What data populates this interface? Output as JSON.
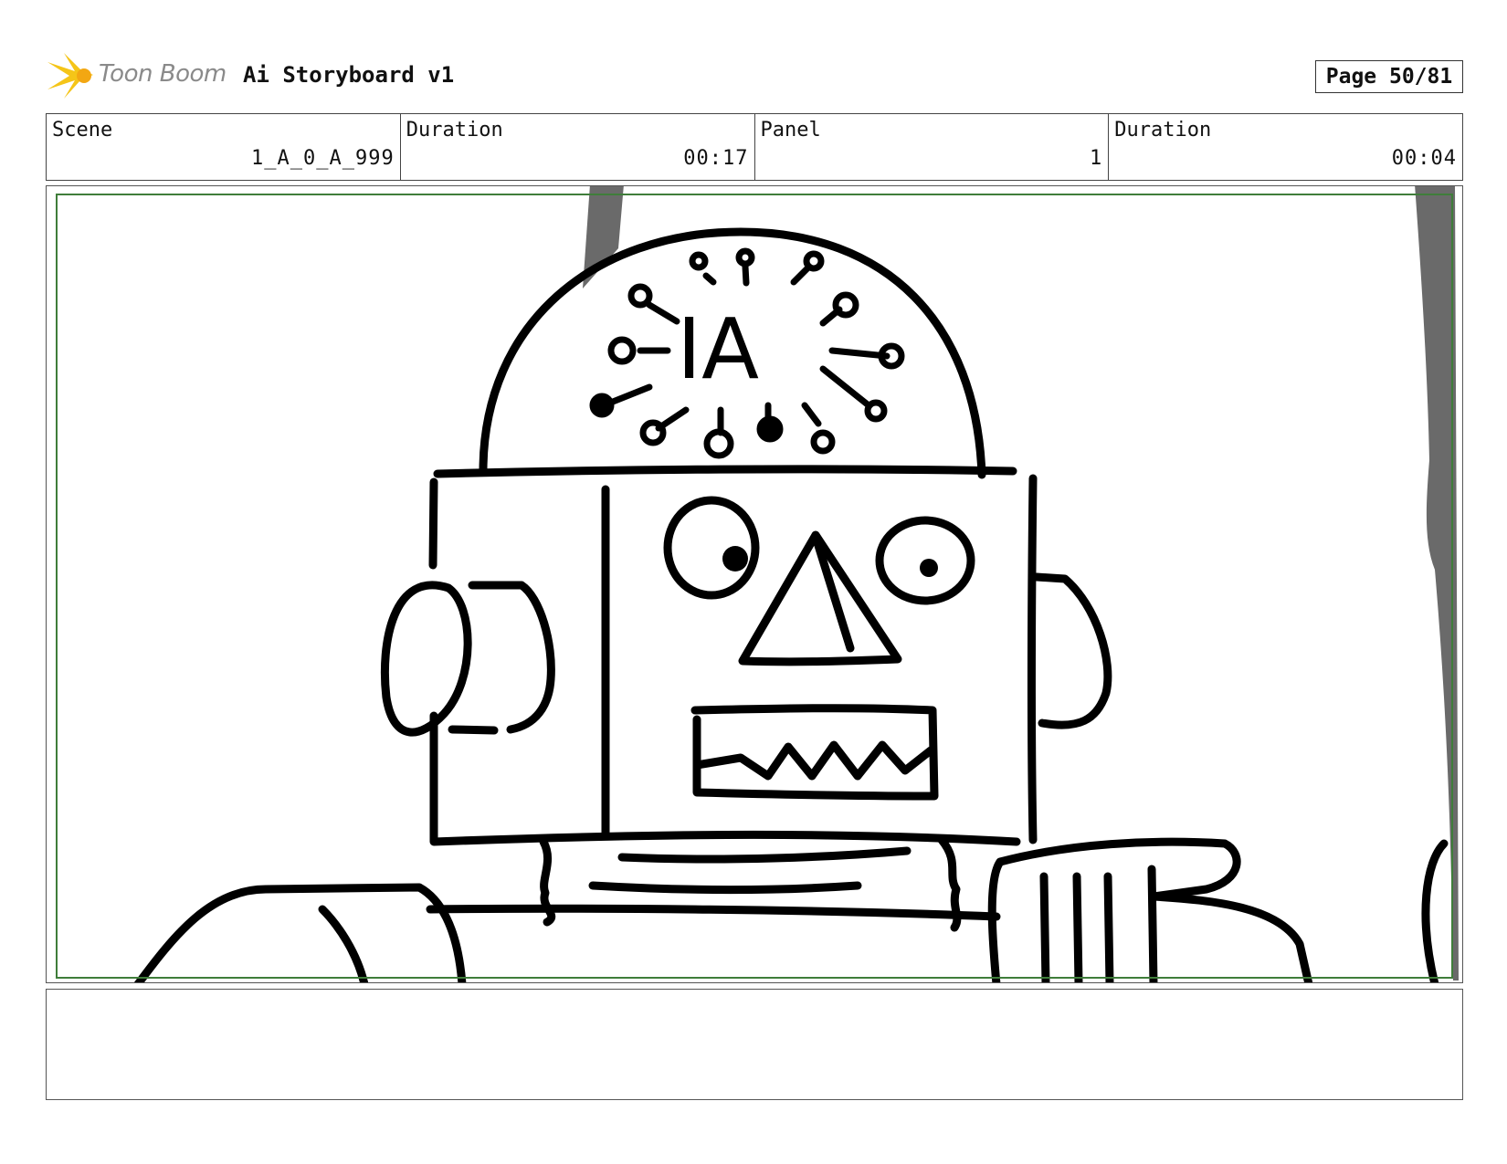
{
  "header": {
    "logo_text": "Toon Boom",
    "title": "Ai Storyboard v1",
    "page_label": "Page 50/81"
  },
  "info": {
    "scene_label": "Scene",
    "scene_value": "1_A_0_A_999",
    "scene_duration_label": "Duration",
    "scene_duration_value": "00:17",
    "panel_label": "Panel",
    "panel_value": "1",
    "panel_duration_label": "Duration",
    "panel_duration_value": "00:04"
  },
  "panel": {
    "brain_text": "IA"
  },
  "notes": {
    "text": ""
  },
  "colors": {
    "safe_frame": "#3f7d3a",
    "logo_star": "#f5c518",
    "logo_text": "#8a8a8a"
  }
}
